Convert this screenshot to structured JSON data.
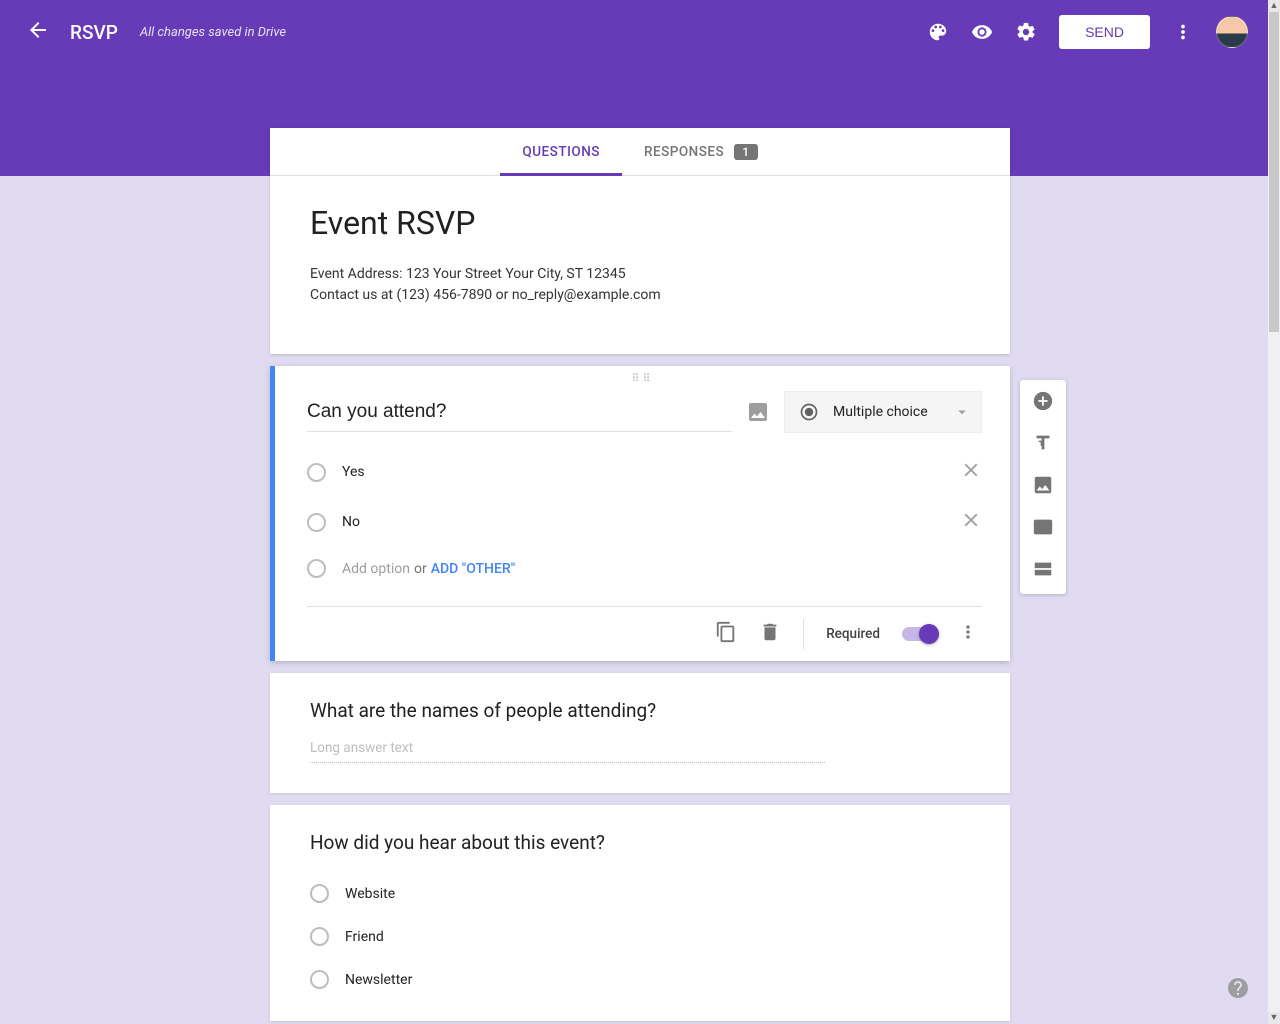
{
  "header": {
    "doc_title": "RSVP",
    "save_status": "All changes saved in Drive",
    "send_label": "SEND"
  },
  "tabs": {
    "questions": "QUESTIONS",
    "responses": "RESPONSES",
    "responses_count": "1"
  },
  "form": {
    "title": "Event RSVP",
    "description_line1": "Event Address: 123 Your Street Your City, ST 12345",
    "description_line2": "Contact us at (123) 456-7890 or no_reply@example.com"
  },
  "q1": {
    "title": "Can you attend?",
    "type_label": "Multiple choice",
    "options": [
      "Yes",
      "No"
    ],
    "add_option_placeholder": "Add option",
    "or_text": "or",
    "add_other": "ADD \"OTHER\"",
    "required_label": "Required"
  },
  "q2": {
    "title": "What are the names of people attending?",
    "placeholder": "Long answer text"
  },
  "q3": {
    "title": "How did you hear about this event?",
    "options": [
      "Website",
      "Friend",
      "Newsletter"
    ]
  }
}
